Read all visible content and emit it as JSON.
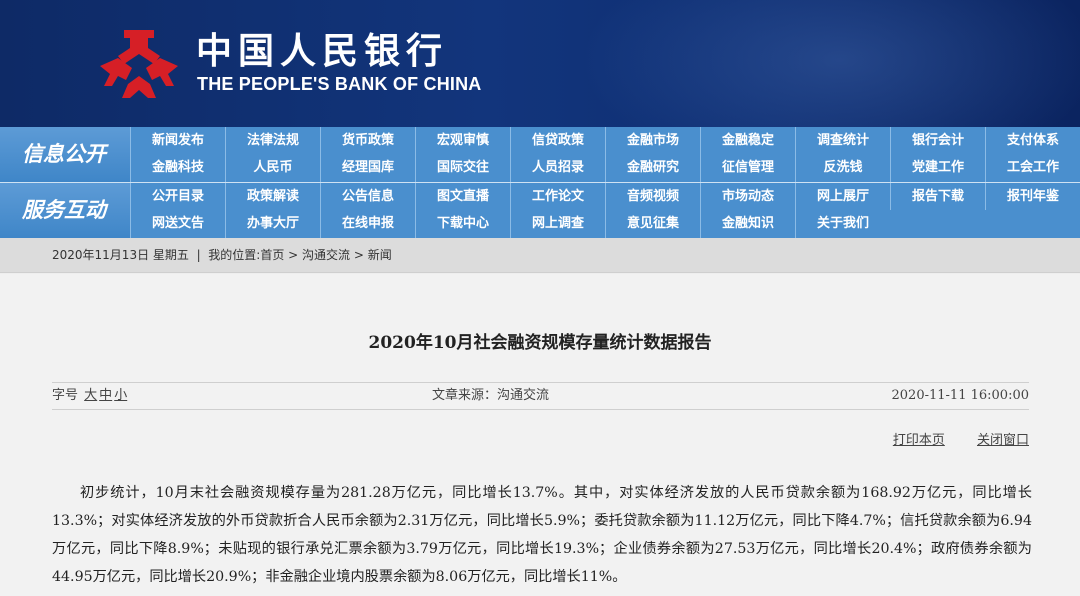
{
  "header": {
    "title_cn": "中国人民银行",
    "title_en": "THE PEOPLE'S BANK OF CHINA",
    "emblem_icon": "pboc-emblem-icon",
    "colors": {
      "banner": "#12357c",
      "emblem": "#d61f26",
      "nav": "#4a8fce"
    }
  },
  "nav": {
    "sections": [
      {
        "label": "信息公开",
        "rows": [
          [
            "新闻发布",
            "法律法规",
            "货币政策",
            "宏观审慎",
            "信贷政策",
            "金融市场",
            "金融稳定",
            "调查统计",
            "银行会计",
            "支付体系"
          ],
          [
            "金融科技",
            "人民币",
            "经理国库",
            "国际交往",
            "人员招录",
            "金融研究",
            "征信管理",
            "反洗钱",
            "党建工作",
            "工会工作"
          ]
        ]
      },
      {
        "label": "服务互动",
        "rows": [
          [
            "公开目录",
            "政策解读",
            "公告信息",
            "图文直播",
            "工作论文",
            "音频视频",
            "市场动态",
            "网上展厅",
            "报告下载",
            "报刊年鉴"
          ],
          [
            "网送文告",
            "办事大厅",
            "在线申报",
            "下载中心",
            "网上调查",
            "意见征集",
            "金融知识",
            "关于我们"
          ]
        ]
      }
    ]
  },
  "breadcrumb": {
    "date": "2020年11月13日 星期五",
    "sep": "|",
    "location_label": "我的位置:",
    "path": [
      "首页",
      "沟通交流",
      "新闻"
    ],
    "arrow": ">"
  },
  "article": {
    "title": "2020年10月社会融资规模存量统计数据报告",
    "font_label": "字号",
    "font_sizes": [
      "大",
      "中",
      "小"
    ],
    "source": "文章来源：沟通交流",
    "datetime": "2020-11-11 16:00:00",
    "print_label": "打印本页",
    "close_label": "关闭窗口",
    "body": "初步统计，10月末社会融资规模存量为281.28万亿元，同比增长13.7%。其中，对实体经济发放的人民币贷款余额为168.92万亿元，同比增长13.3%；对实体经济发放的外币贷款折合人民币余额为2.31万亿元，同比增长5.9%；委托贷款余额为11.12万亿元，同比下降4.7%；信托贷款余额为6.94万亿元，同比下降8.9%；未贴现的银行承兑汇票余额为3.79万亿元，同比增长19.3%；企业债券余额为27.53万亿元，同比增长20.4%；政府债券余额为44.95万亿元，同比增长20.9%；非金融企业境内股票余额为8.06万亿元，同比增长11%。"
  }
}
